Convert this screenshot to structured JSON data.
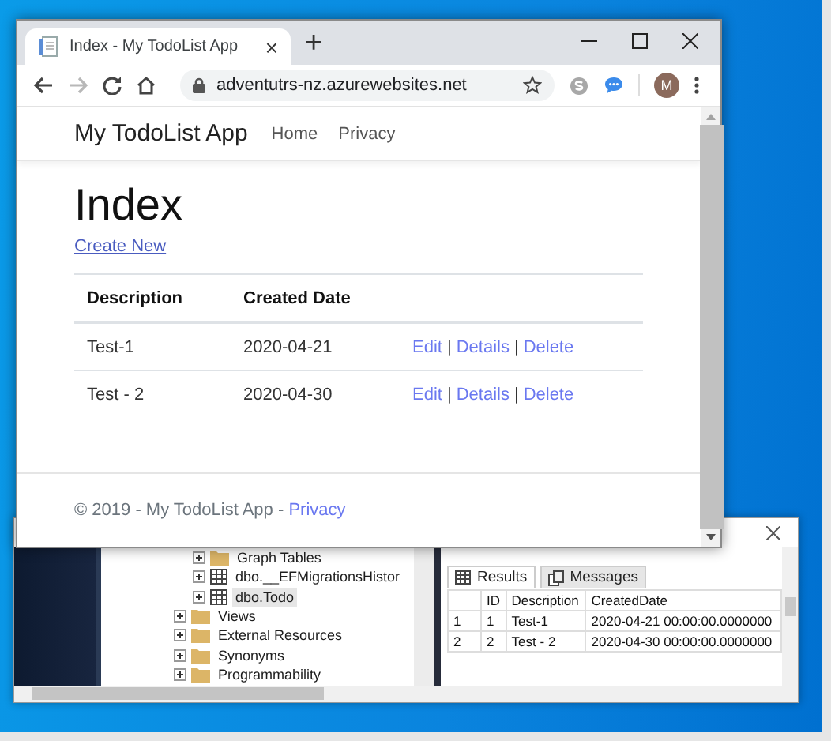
{
  "browser": {
    "tab": {
      "title": "Index - My TodoList App",
      "close": "×"
    },
    "new_tab": "+",
    "forward_button": {
      "disabled": true
    },
    "address": "adventutrs-nz.azurewebsites.net",
    "avatar": "M",
    "site": {
      "brand": "My TodoList App",
      "nav": [
        "Home",
        "Privacy"
      ],
      "heading": "Index",
      "create_link": "Create New",
      "columns": [
        "Description",
        "Created Date"
      ],
      "rows": [
        {
          "description": "Test-1",
          "created": "2020-04-21",
          "actions": [
            {
              "kind": "link",
              "label": "Edit"
            },
            {
              "kind": "separator",
              "label": "|"
            },
            {
              "kind": "link",
              "label": "Details"
            },
            {
              "kind": "separator",
              "label": "|"
            },
            {
              "kind": "link",
              "label": "Delete"
            }
          ]
        },
        {
          "description": "Test - 2",
          "created": "2020-04-30",
          "actions": [
            {
              "kind": "link",
              "label": "Edit"
            },
            {
              "kind": "separator",
              "label": "|"
            },
            {
              "kind": "link",
              "label": "Details"
            },
            {
              "kind": "separator",
              "label": "|"
            },
            {
              "kind": "link",
              "label": "Delete"
            }
          ]
        }
      ],
      "footer": {
        "text": "© 2019 - My TodoList App - ",
        "link": "Privacy"
      }
    }
  },
  "ssms": {
    "tree": [
      {
        "children": [
          {
            "label": "Graph Tables",
            "kind": "folder",
            "expanded": false,
            "selected": false
          },
          {
            "label": "dbo.__EFMigrationsHistor",
            "kind": "table",
            "expanded": false,
            "selected": false
          },
          {
            "label": "dbo.Todo",
            "kind": "table",
            "expanded": false,
            "selected": true
          }
        ]
      },
      {
        "label": "Views",
        "kind": "folder",
        "expanded": false,
        "selected": false
      },
      {
        "label": "External Resources",
        "kind": "folder",
        "expanded": false,
        "selected": false
      },
      {
        "label": "Synonyms",
        "kind": "folder",
        "expanded": false,
        "selected": false
      },
      {
        "label": "Programmability",
        "kind": "folder",
        "expanded": false,
        "selected": false
      }
    ],
    "result_tabs": [
      {
        "label": "Results",
        "kind": "grid",
        "selected": true
      },
      {
        "label": "Messages",
        "kind": "messages",
        "selected": false
      }
    ],
    "grid": {
      "columns": [
        "ID",
        "Description",
        "CreatedDate"
      ],
      "rows": [
        {
          "row_number": "1",
          "cells": [
            "1",
            "Test-1",
            "2020-04-21 00:00:00.0000000"
          ]
        },
        {
          "row_number": "2",
          "cells": [
            "2",
            "Test - 2",
            "2020-04-30 00:00:00.0000000"
          ]
        }
      ]
    }
  }
}
